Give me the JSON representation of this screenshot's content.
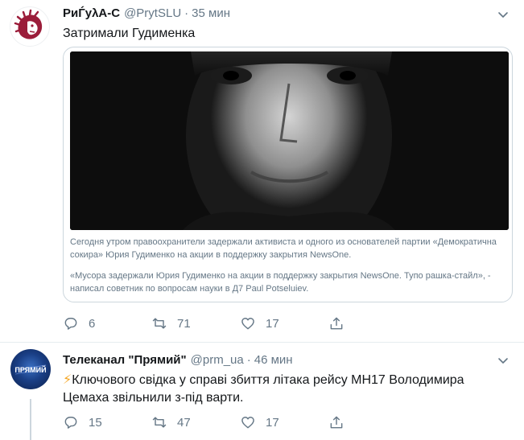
{
  "tweets": [
    {
      "author_name": "PиЃуλА-С",
      "handle": "@PrytSLU",
      "time": "35 мин",
      "text": "Затримали Гудименка",
      "card": {
        "paragraph_1": "Сегодня утром правоохранители задержали активиста и одного из основателей партии «Демократична сокира» Юрия Гудименко на акции в поддержку закрытия NewsOne.",
        "paragraph_2": "«Мусора задержали Юрия Гудименко на акции в поддержку закрытия NewsOne. Тупо рашка-стайл», - написал советник по вопросам науки в Д7 Paul Potseluiev."
      },
      "replies": "6",
      "retweets": "71",
      "likes": "17"
    },
    {
      "author_name": "Телеканал \"Прямий\"",
      "handle": "@prm_ua",
      "time": "46 мин",
      "avatar_label": "ПРЯМИЙ",
      "text_prefix": "⚡",
      "text": "Ключового свідка у справі збиття літака рейсу МН17 Володимира Цемаха звільнили з-під варти.",
      "replies": "15",
      "retweets": "47",
      "likes": "17"
    }
  ],
  "colors": {
    "text_primary": "#14171a",
    "text_secondary": "#657786",
    "border": "#e6ecf0",
    "card_border": "#ccd6dd",
    "avatar_lion": "#9b1d3a",
    "bolt": "#f5a623"
  },
  "icons": [
    "reply-icon",
    "retweet-icon",
    "like-icon",
    "share-icon",
    "chevron-down-icon"
  ]
}
